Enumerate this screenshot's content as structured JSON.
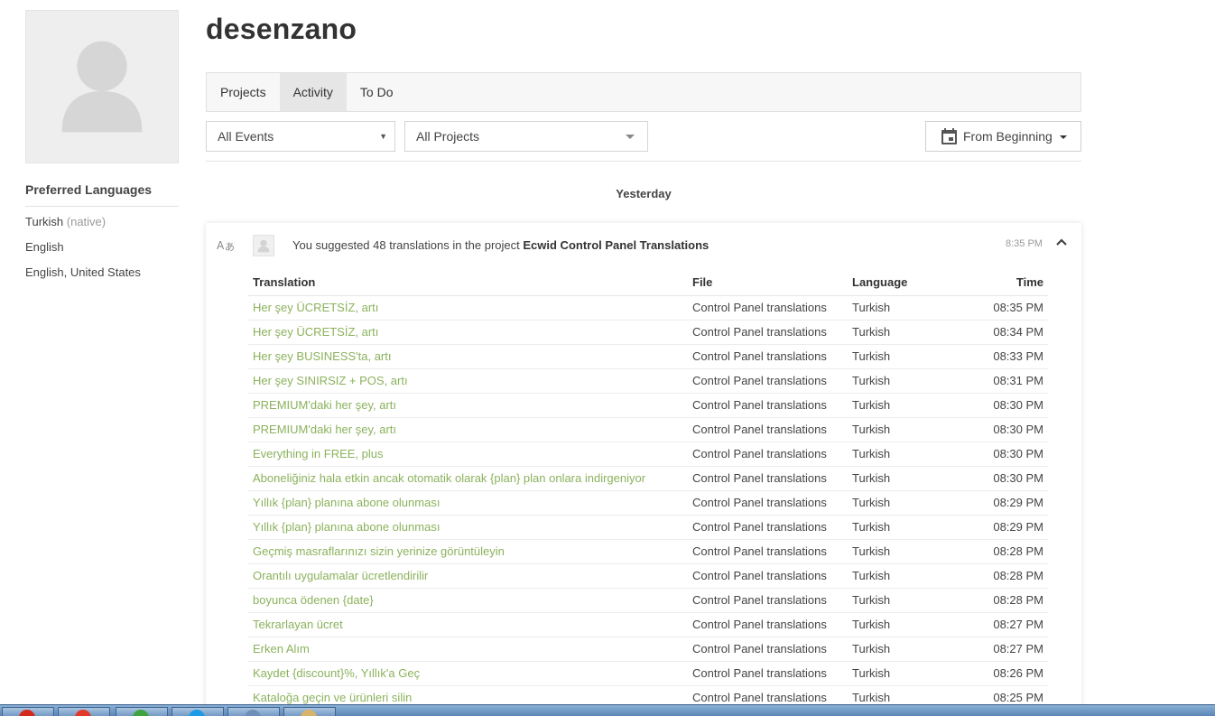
{
  "profile": {
    "username": "desenzano",
    "preferred_languages_title": "Preferred Languages",
    "languages": [
      {
        "name": "Turkish",
        "note": "(native)"
      },
      {
        "name": "English",
        "note": ""
      },
      {
        "name": "English, United States",
        "note": ""
      }
    ]
  },
  "tabs": [
    {
      "label": "Projects",
      "active": false
    },
    {
      "label": "Activity",
      "active": true
    },
    {
      "label": "To Do",
      "active": false
    }
  ],
  "filters": {
    "events": "All Events",
    "projects": "All Projects",
    "date": "From Beginning"
  },
  "day_label": "Yesterday",
  "activity": {
    "summary_prefix": "You suggested 48 translations in the project",
    "project_name": "Ecwid Control Panel Translations",
    "time": "8:35 PM",
    "icon_translate": "translate-icon",
    "icon_collapse": "chevron-up-icon",
    "columns": [
      "Translation",
      "File",
      "Language",
      "Time"
    ],
    "rows": [
      {
        "translation": "Her şey ÜCRETSİZ, artı",
        "file": "Control Panel translations",
        "language": "Turkish",
        "time": "08:35 PM"
      },
      {
        "translation": "Her şey ÜCRETSİZ, artı",
        "file": "Control Panel translations",
        "language": "Turkish",
        "time": "08:34 PM"
      },
      {
        "translation": "Her şey BUSINESS'ta, artı",
        "file": "Control Panel translations",
        "language": "Turkish",
        "time": "08:33 PM"
      },
      {
        "translation": "Her şey SINIRSIZ + POS, artı",
        "file": "Control Panel translations",
        "language": "Turkish",
        "time": "08:31 PM"
      },
      {
        "translation": "PREMIUM'daki her şey, artı",
        "file": "Control Panel translations",
        "language": "Turkish",
        "time": "08:30 PM"
      },
      {
        "translation": "PREMIUM'daki her şey, artı",
        "file": "Control Panel translations",
        "language": "Turkish",
        "time": "08:30 PM"
      },
      {
        "translation": "Everything in FREE, plus",
        "file": "Control Panel translations",
        "language": "Turkish",
        "time": "08:30 PM"
      },
      {
        "translation": "Aboneliğiniz hala etkin ancak otomatik olarak {plan} plan onlara indirgeniyor",
        "file": "Control Panel translations",
        "language": "Turkish",
        "time": "08:30 PM"
      },
      {
        "translation": "Yıllık {plan} planına abone olunması",
        "file": "Control Panel translations",
        "language": "Turkish",
        "time": "08:29 PM"
      },
      {
        "translation": "Yıllık {plan} planına abone olunması",
        "file": "Control Panel translations",
        "language": "Turkish",
        "time": "08:29 PM"
      },
      {
        "translation": "Geçmiş masraflarınızı sizin yerinize görüntüleyin",
        "file": "Control Panel translations",
        "language": "Turkish",
        "time": "08:28 PM"
      },
      {
        "translation": "Orantılı uygulamalar ücretlendirilir",
        "file": "Control Panel translations",
        "language": "Turkish",
        "time": "08:28 PM"
      },
      {
        "translation": "boyunca ödenen {date}",
        "file": "Control Panel translations",
        "language": "Turkish",
        "time": "08:28 PM"
      },
      {
        "translation": "Tekrarlayan ücret",
        "file": "Control Panel translations",
        "language": "Turkish",
        "time": "08:27 PM"
      },
      {
        "translation": "Erken Alım",
        "file": "Control Panel translations",
        "language": "Turkish",
        "time": "08:27 PM"
      },
      {
        "translation": "Kaydet {discount}%, Yıllık'a Geç",
        "file": "Control Panel translations",
        "language": "Turkish",
        "time": "08:26 PM"
      },
      {
        "translation": "Kataloğa geçin ve ürünleri silin",
        "file": "Control Panel translations",
        "language": "Turkish",
        "time": "08:25 PM"
      }
    ]
  },
  "colors": {
    "translation_link": "#8bb25c",
    "tab_active_bg": "#e6e6e6",
    "tab_bar_bg": "#f7f7f7"
  }
}
